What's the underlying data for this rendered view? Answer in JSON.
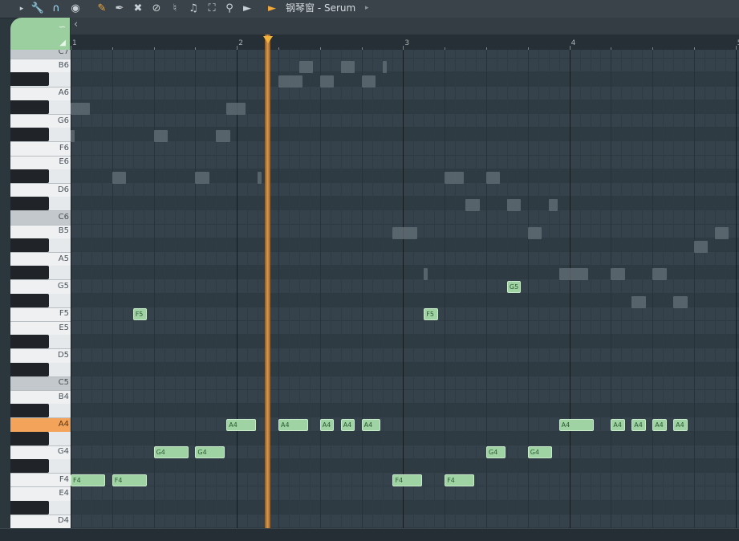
{
  "toolbar": {
    "title": "钢琴窗 - Serum",
    "icons": [
      "menu-arrow-icon",
      "wrench-icon",
      "magnet-icon",
      "stamp-icon",
      "pencil-icon",
      "paint-icon",
      "delete-icon",
      "mute-icon",
      "speaker-mute-icon",
      "slice-icon",
      "select-icon",
      "zoom-icon",
      "playback-icon",
      "speaker-icon"
    ]
  },
  "ruler": {
    "bars": [
      "1",
      "2",
      "3",
      "4",
      "5"
    ]
  },
  "keys": {
    "labels": [
      "C7",
      "B6",
      "A6",
      "G6",
      "F6",
      "E6",
      "D6",
      "C6",
      "B5",
      "A5",
      "G5",
      "F5",
      "E5",
      "D5",
      "C5",
      "B4",
      "A4",
      "G4",
      "F4",
      "E4",
      "D4"
    ],
    "active": "A4"
  },
  "notes": [
    {
      "pitch": "F4",
      "label": "F4",
      "start": 0.0,
      "len": 0.875
    },
    {
      "pitch": "F4",
      "label": "F4",
      "start": 1.0,
      "len": 0.875
    },
    {
      "pitch": "G4",
      "label": "G4",
      "start": 2.0,
      "len": 0.875
    },
    {
      "pitch": "G4",
      "label": "G4",
      "start": 3.0,
      "len": 0.75
    },
    {
      "pitch": "F5",
      "label": "F5",
      "start": 1.5,
      "len": 0.375
    },
    {
      "pitch": "A4",
      "label": "A4",
      "start": 3.75,
      "len": 0.75
    },
    {
      "pitch": "A4",
      "label": "A4",
      "start": 5.0,
      "len": 0.75
    },
    {
      "pitch": "A4",
      "label": "A4",
      "start": 6.0,
      "len": 0.375
    },
    {
      "pitch": "A4",
      "label": "A4",
      "start": 6.5,
      "len": 0.375
    },
    {
      "pitch": "A4",
      "label": "A4",
      "start": 7.0,
      "len": 0.5
    },
    {
      "pitch": "F4",
      "label": "F4",
      "start": 7.75,
      "len": 0.75
    },
    {
      "pitch": "F5",
      "label": "F5",
      "start": 8.5,
      "len": 0.375
    },
    {
      "pitch": "F4",
      "label": "F4",
      "start": 9.0,
      "len": 0.75
    },
    {
      "pitch": "G4",
      "label": "G4",
      "start": 10.0,
      "len": 0.5
    },
    {
      "pitch": "G5",
      "label": "G5",
      "start": 10.5,
      "len": 0.375
    },
    {
      "pitch": "G4",
      "label": "G4",
      "start": 11.0,
      "len": 0.625
    },
    {
      "pitch": "A4",
      "label": "A4",
      "start": 11.75,
      "len": 0.875
    },
    {
      "pitch": "A4",
      "label": "A4",
      "start": 13.0,
      "len": 0.375
    },
    {
      "pitch": "A4",
      "label": "A4",
      "start": 13.5,
      "len": 0.375
    },
    {
      "pitch": "A4",
      "label": "A4",
      "start": 14.0,
      "len": 0.375
    },
    {
      "pitch": "A4",
      "label": "A4",
      "start": 14.5,
      "len": 0.375
    }
  ],
  "ghost_notes": [
    {
      "row": 0.3,
      "start": 5.5,
      "len": 0.375
    },
    {
      "row": 0.3,
      "start": 6.5,
      "len": 0.375
    },
    {
      "row": 0.3,
      "start": 7.5,
      "len": 0.125
    },
    {
      "row": 0.8,
      "start": 5.0,
      "len": 0.625
    },
    {
      "row": 0.8,
      "start": 6.0,
      "len": 0.375
    },
    {
      "row": 0.8,
      "start": 7.0,
      "len": 0.375
    },
    {
      "row": 1.8,
      "start": 0.0,
      "len": 0.5
    },
    {
      "row": 1.8,
      "start": 3.75,
      "len": 0.5
    },
    {
      "row": 2.8,
      "start": 0.0,
      "len": 0.125
    },
    {
      "row": 2.8,
      "start": 2.0,
      "len": 0.375
    },
    {
      "row": 2.8,
      "start": 3.5,
      "len": 0.375
    },
    {
      "row": 4.3,
      "start": 1.0,
      "len": 0.375
    },
    {
      "row": 4.3,
      "start": 3.0,
      "len": 0.375
    },
    {
      "row": 4.3,
      "start": 4.5,
      "len": 0.125
    },
    {
      "row": 4.3,
      "start": 9.0,
      "len": 0.5
    },
    {
      "row": 4.3,
      "start": 10.0,
      "len": 0.375
    },
    {
      "row": 5.3,
      "start": 9.5,
      "len": 0.375
    },
    {
      "row": 5.3,
      "start": 10.5,
      "len": 0.375
    },
    {
      "row": 5.3,
      "start": 11.5,
      "len": 0.25
    },
    {
      "row": 6.3,
      "start": 7.75,
      "len": 0.625
    },
    {
      "row": 6.3,
      "start": 11.0,
      "len": 0.375
    },
    {
      "row": 6.3,
      "start": 15.5,
      "len": 0.375
    },
    {
      "row": 6.8,
      "start": 15.0,
      "len": 0.375
    },
    {
      "row": 7.8,
      "start": 8.5,
      "len": 0.125
    },
    {
      "row": 7.8,
      "start": 11.75,
      "len": 0.75
    },
    {
      "row": 7.8,
      "start": 13.0,
      "len": 0.375
    },
    {
      "row": 7.8,
      "start": 14.0,
      "len": 0.375
    },
    {
      "row": 8.8,
      "start": 13.5,
      "len": 0.375
    },
    {
      "row": 8.8,
      "start": 14.5,
      "len": 0.375
    }
  ]
}
